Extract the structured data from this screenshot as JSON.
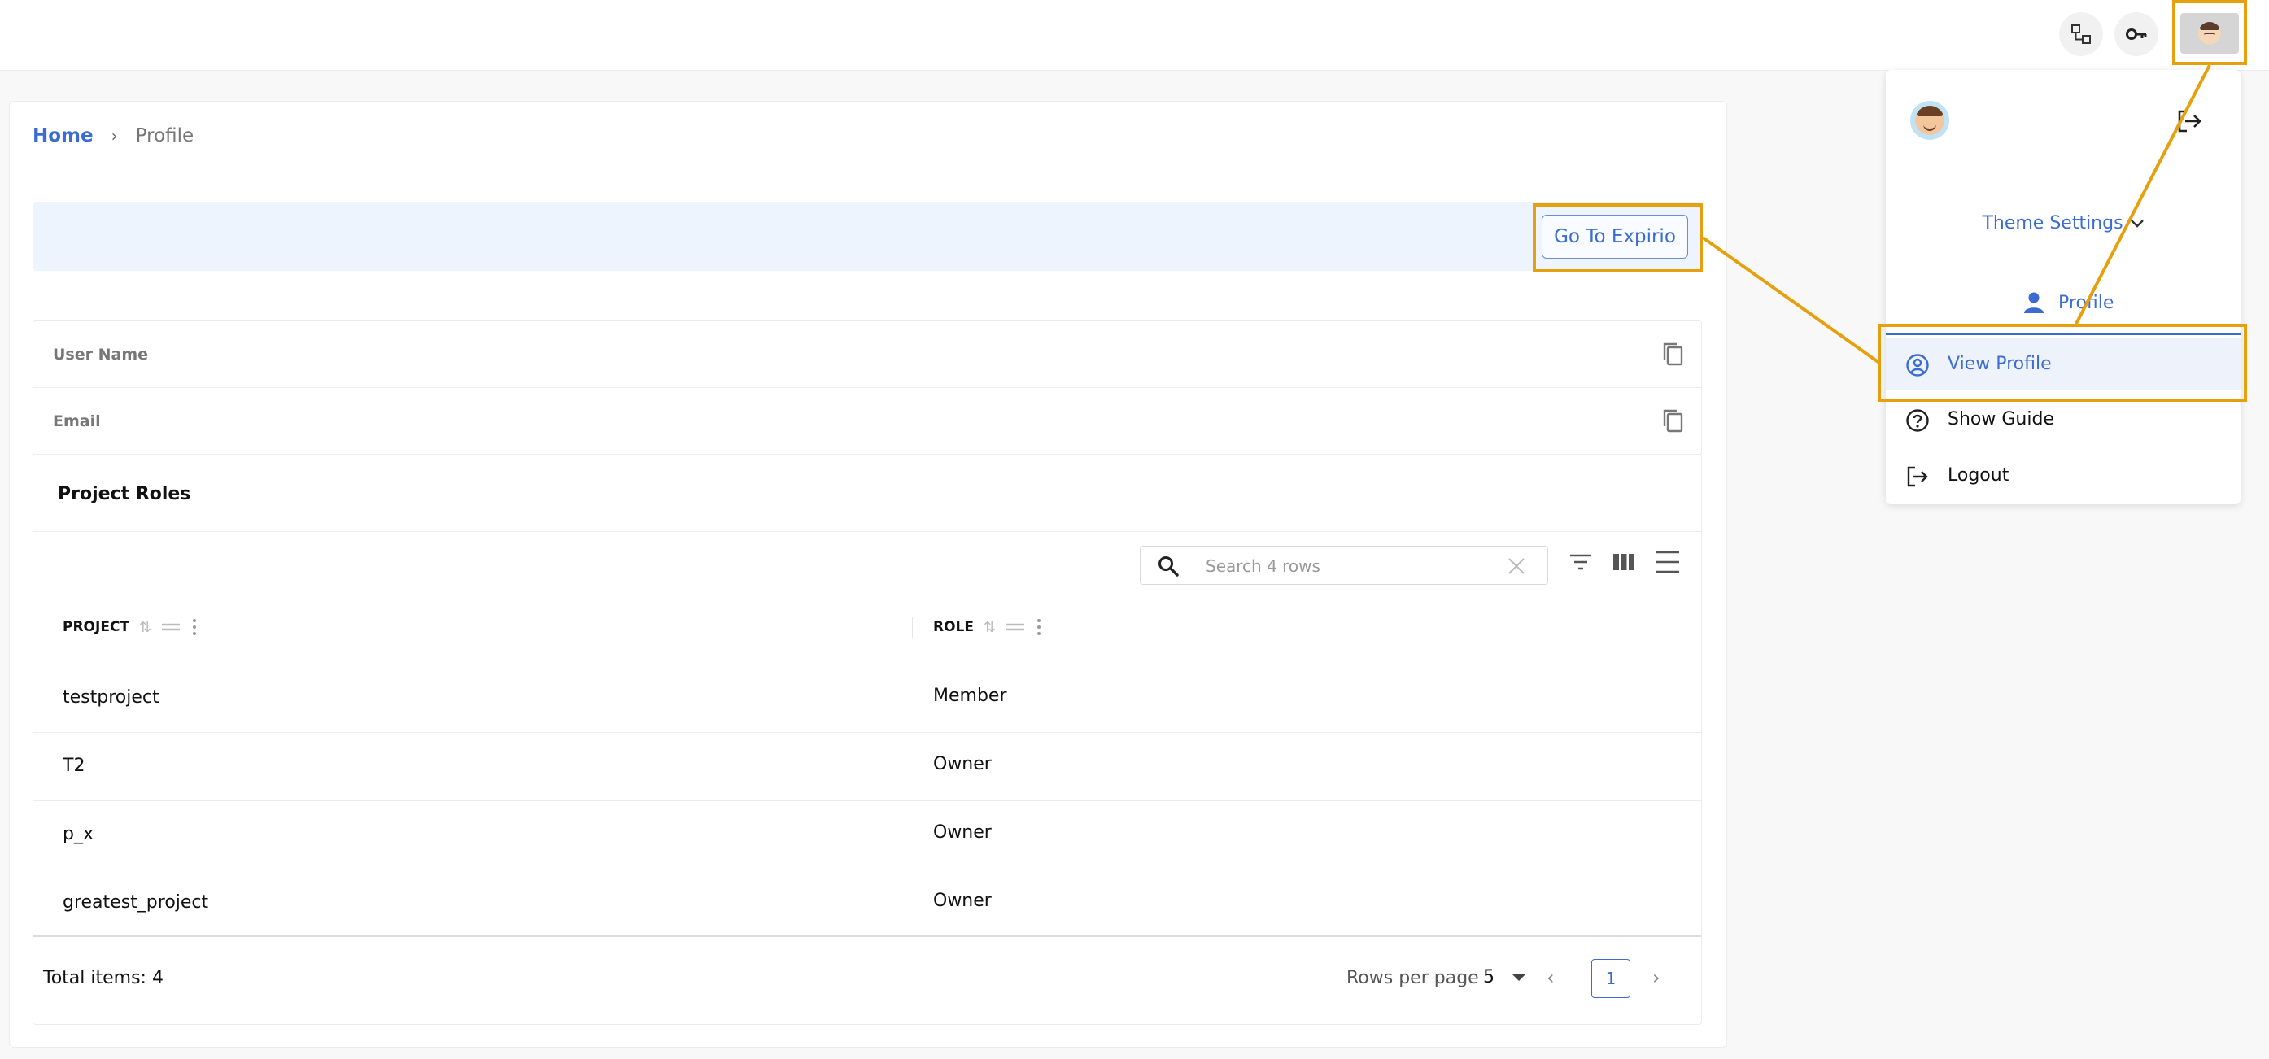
{
  "topbar": {
    "icons": [
      "diagram-icon",
      "key-icon"
    ],
    "avatar": "user-avatar"
  },
  "breadcrumb": {
    "home": "Home",
    "separator": "›",
    "current": "Profile"
  },
  "banner": {
    "button_label": "Go To Expirio"
  },
  "user_info": {
    "fields": [
      {
        "label": "User Name"
      },
      {
        "label": "Email"
      }
    ]
  },
  "project_roles": {
    "title": "Project Roles",
    "search": {
      "placeholder": "Search 4 rows"
    },
    "columns": [
      "PROJECT",
      "ROLE"
    ],
    "rows": [
      {
        "project": "testproject",
        "role": "Member"
      },
      {
        "project": "T2",
        "role": "Owner"
      },
      {
        "project": "p_x",
        "role": "Owner"
      },
      {
        "project": "greatest_project",
        "role": "Owner"
      }
    ],
    "footer": {
      "total": "Total items: 4",
      "rows_per_page_label": "Rows per page",
      "rows_per_page_value": "5",
      "prev": "‹",
      "current_page": "1",
      "next": "›"
    }
  },
  "user_menu": {
    "theme_settings": "Theme Settings",
    "profile_header": "Profile",
    "items": [
      {
        "label": "View Profile",
        "active": true
      },
      {
        "label": "Show Guide",
        "active": false
      },
      {
        "label": "Logout",
        "active": false
      }
    ]
  },
  "colors": {
    "accent": "#3c6cd1",
    "highlight": "#e6a00e",
    "banner_bg": "#eef4fd"
  }
}
